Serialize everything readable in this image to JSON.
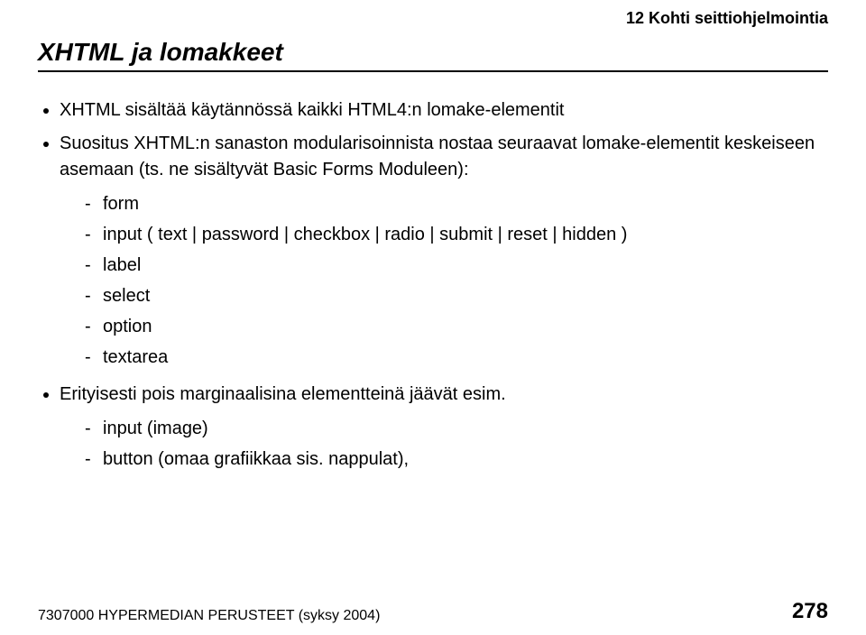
{
  "header": {
    "chapter": "12 Kohti seittiohjelmointia"
  },
  "title": "XHTML ja lomakkeet",
  "bullets": [
    {
      "text": "XHTML sisältää käytännössä kaikki HTML4:n lomake-elementit"
    },
    {
      "text": "Suositus XHTML:n sanaston modularisoinnista nostaa seuraavat lomake-elementit keskeiseen asemaan (ts. ne sisältyvät Basic Forms Moduleen):",
      "sub": [
        "form",
        "input ( text | password | checkbox | radio | submit | reset | hidden )",
        "label",
        "select",
        "option",
        "textarea"
      ]
    },
    {
      "text": "Erityisesti pois marginaalisina elementteinä jäävät esim.",
      "sub": [
        "input (image)",
        "button (omaa grafiikkaa sis. nappulat),"
      ]
    }
  ],
  "footer": {
    "course": "7307000 HYPERMEDIAN PERUSTEET (syksy 2004)",
    "page": "278"
  }
}
